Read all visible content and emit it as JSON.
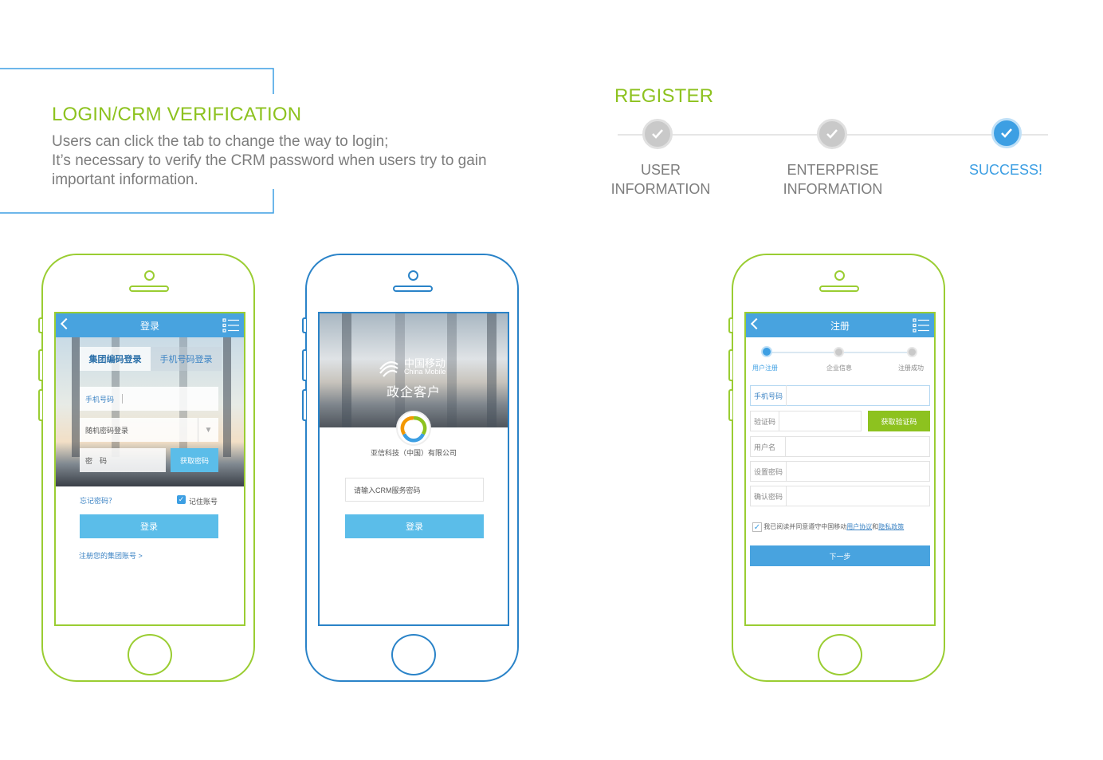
{
  "login_section": {
    "title": "LOGIN/CRM VERIFICATION",
    "description_lines": [
      "Users can click the tab to change the way to login;",
      "It’s necessary to verify the CRM password when users try to gain",
      "important information."
    ]
  },
  "register_section": {
    "title": "REGISTER",
    "steps": [
      {
        "line1": "USER",
        "line2": "INFORMATION",
        "state": "done"
      },
      {
        "line1": "ENTERPRISE",
        "line2": "INFORMATION",
        "state": "done"
      },
      {
        "line1": "SUCCESS!",
        "line2": "",
        "state": "success"
      }
    ]
  },
  "phone_login": {
    "appbar_title": "登录",
    "tabs": [
      "集团编码登录",
      "手机号码登录"
    ],
    "phone_field_label": "手机号码",
    "login_mode_select": "随机密码登录",
    "password_label": "密　码",
    "get_password_button": "获取密码",
    "forgot_password_link": "忘记密码？",
    "remember_label": "记住账号",
    "login_button": "登录",
    "register_link": "注册您的集团账号 >"
  },
  "phone_crm": {
    "brand_cn": "中国移动",
    "brand_en": "China Mobile",
    "subtitle": "政企客户",
    "company": "亚信科技（中国）有限公司",
    "crm_placeholder": "请输入CRM服务密码",
    "login_button": "登录"
  },
  "phone_register": {
    "appbar_title": "注册",
    "steps": [
      "用户注册",
      "企业信息",
      "注册成功"
    ],
    "fields": [
      "手机号码",
      "验证码",
      "用户名",
      "设置密码",
      "确认密码"
    ],
    "get_code_button": "获取验证码",
    "agree_prefix": "我已阅读并同意遵守中国移动",
    "agree_terms": "用户协议",
    "agree_and": "和",
    "agree_privacy": "隐私政策",
    "next_button": "下一步"
  },
  "colors": {
    "accent_green": "#8dc21f",
    "accent_blue": "#3d9fe3",
    "text_gray": "#7d7d7d"
  }
}
